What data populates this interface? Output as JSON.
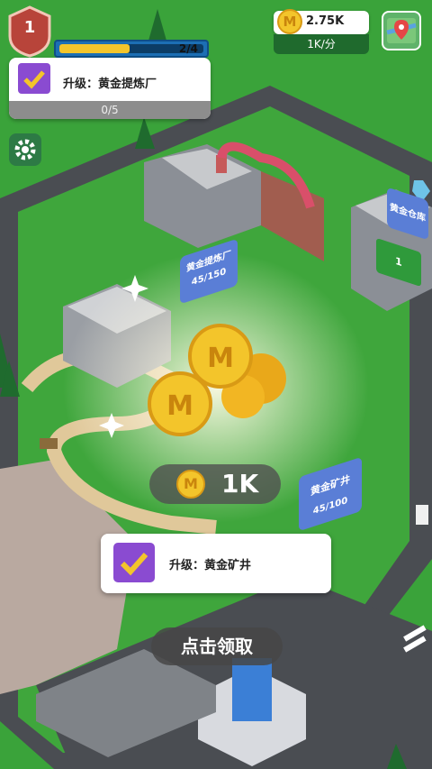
{
  "hud": {
    "level": "1",
    "xp_text": "2/4",
    "xp_progress": 0.5,
    "task": {
      "title": "升级：黄金提炼厂",
      "progress": "0/5"
    },
    "coins": "2.75K",
    "coin_symbol": "M",
    "rate": "1K/分"
  },
  "world": {
    "refinery_sign": "黄金提炼厂",
    "refinery_count": "45/150",
    "warehouse_sign": "黄金仓库",
    "warehouse_count": "1",
    "mine_sign": "黄金矿井",
    "mine_count": "45/100"
  },
  "reward": {
    "amount": "1K",
    "coin_symbol": "M",
    "upgrade_title": "升级：黄金矿井",
    "claim_label": "点击领取"
  },
  "colors": {
    "grass": "#3aa33a",
    "road": "#4a4d52",
    "gold": "#f3c52b",
    "hud_blue": "#1c6fb4",
    "hud_green": "#1f6a2d"
  }
}
